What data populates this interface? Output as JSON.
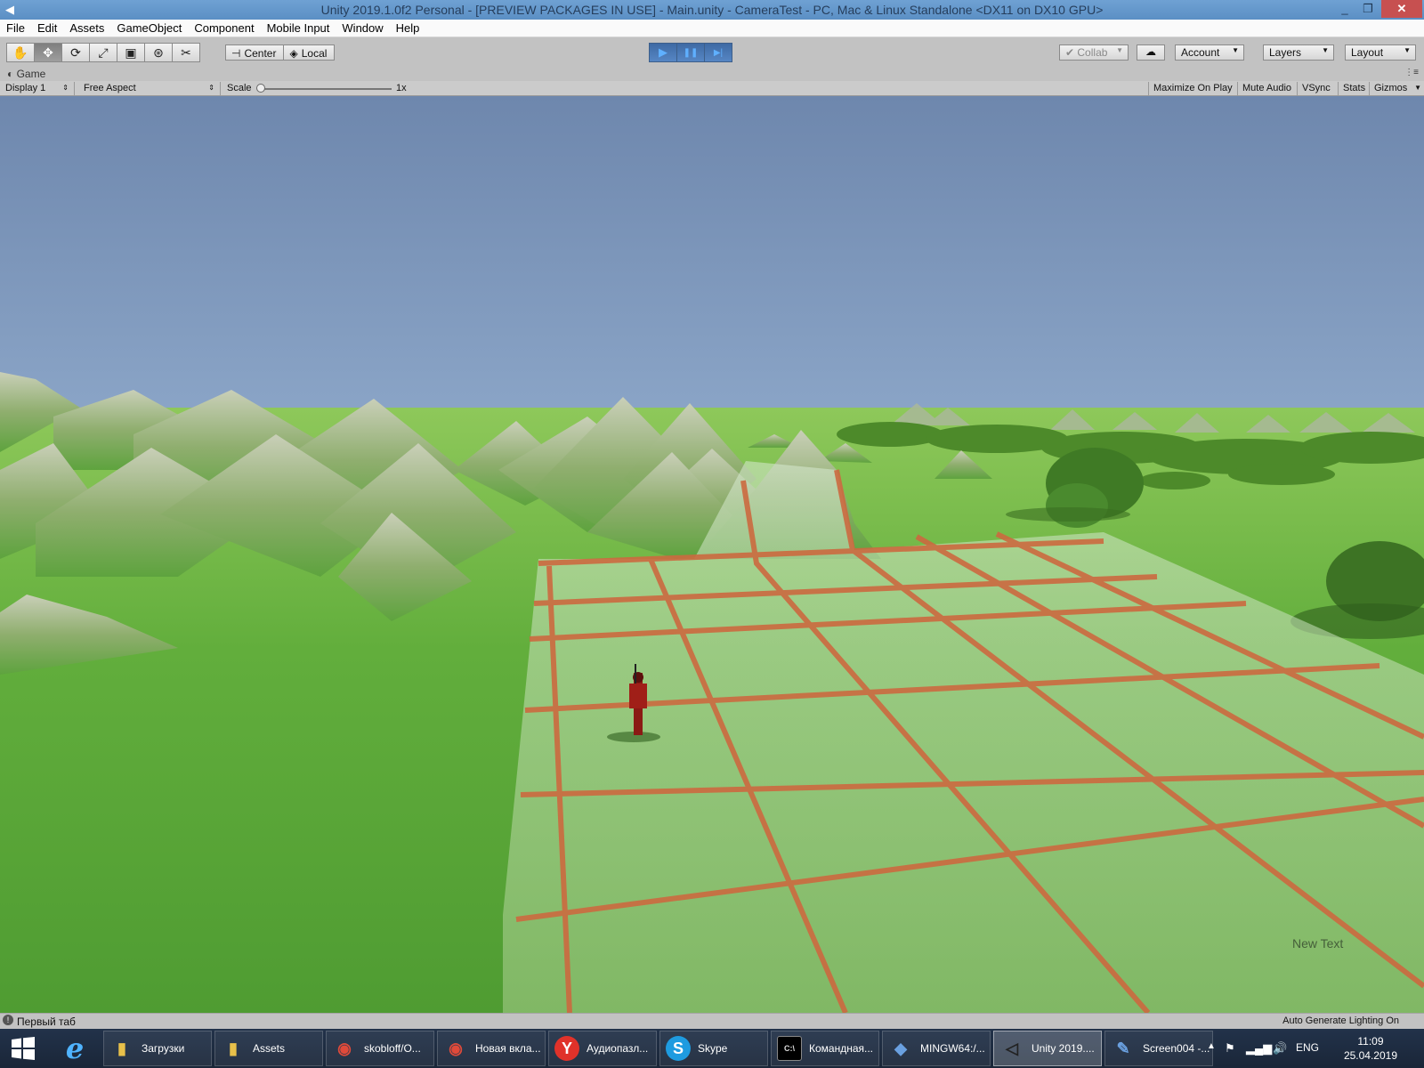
{
  "window": {
    "title": "Unity 2019.1.0f2 Personal - [PREVIEW PACKAGES IN USE] - Main.unity - CameraTest - PC, Mac & Linux Standalone <DX11 on DX10 GPU>",
    "minimize": "_",
    "restore": "❐",
    "close": "✕",
    "app_icon": "◀"
  },
  "menu": [
    "File",
    "Edit",
    "Assets",
    "GameObject",
    "Component",
    "Mobile Input",
    "Window",
    "Help"
  ],
  "toolbar": {
    "tools": [
      {
        "name": "hand-tool",
        "glyph": "✋"
      },
      {
        "name": "move-tool",
        "glyph": "✥"
      },
      {
        "name": "rotate-tool",
        "glyph": "⟳"
      },
      {
        "name": "scale-tool",
        "glyph": "⤢"
      },
      {
        "name": "rect-tool",
        "glyph": "▣"
      },
      {
        "name": "transform-tool",
        "glyph": "⊛"
      },
      {
        "name": "custom-tool",
        "glyph": "✂"
      }
    ],
    "pivot_label": "Center",
    "space_label": "Local",
    "play_glyph": "▶",
    "pause_glyph": "❚❚",
    "step_glyph": "▶|",
    "collab_label": "Collab",
    "cloud_glyph": "☁",
    "account_label": "Account",
    "layers_label": "Layers",
    "layout_label": "Layout"
  },
  "game_tab": {
    "label": "Game",
    "display": "Display 1",
    "aspect": "Free Aspect",
    "scale_label": "Scale",
    "scale_value": "1x",
    "scale_level": 0.0,
    "maximize_on_play": "Maximize On Play",
    "mute_audio": "Mute Audio",
    "vsync": "VSync",
    "stats": "Stats",
    "gizmos": "Gizmos"
  },
  "scene": {
    "overlay_text": "New Text",
    "sky_top": "#6e87ad",
    "sky_horizon": "#cfe3ef",
    "grass": "#5aa83a",
    "grid_line": "#c86a42"
  },
  "status": {
    "message": "Первый таб",
    "lighting": "Auto Generate Lighting On"
  },
  "taskbar": {
    "tasks": [
      {
        "label": "Загрузки",
        "icon": "folder-icon",
        "color": "#e8c04a"
      },
      {
        "label": "Assets",
        "icon": "folder-icon",
        "color": "#e8c04a"
      },
      {
        "label": "skobloff/O...",
        "icon": "chrome-icon",
        "color": "#e04a3a"
      },
      {
        "label": "Новая вкла...",
        "icon": "chrome-icon",
        "color": "#e04a3a"
      },
      {
        "label": "Аудиопазл...",
        "icon": "yandex-icon",
        "color": "#ffffff"
      },
      {
        "label": "Skype",
        "icon": "skype-icon",
        "color": "#1e9be0"
      },
      {
        "label": "Командная...",
        "icon": "cmd-icon",
        "color": "#111111"
      },
      {
        "label": "MINGW64:/...",
        "icon": "git-icon",
        "color": "#6aa0e0"
      },
      {
        "label": "Unity 2019....",
        "icon": "unity-icon",
        "color": "#222222"
      },
      {
        "label": "Screen004 -...",
        "icon": "paint-icon",
        "color": "#6aa0e0"
      }
    ],
    "language": "ENG",
    "time": "11:09",
    "date": "25.04.2019"
  }
}
